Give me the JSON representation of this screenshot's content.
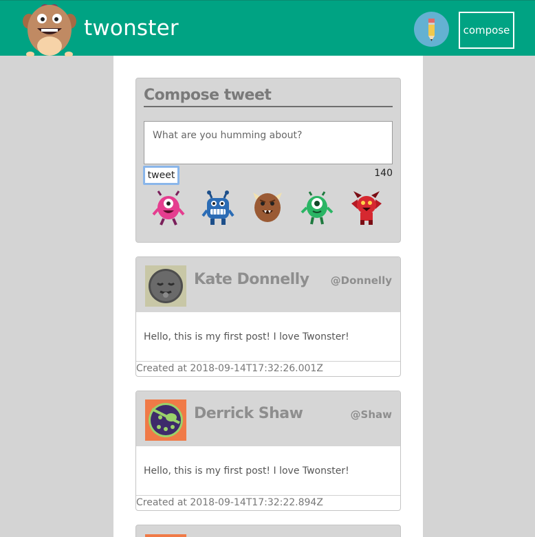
{
  "app": {
    "title": "twonster",
    "compose_label": "compose"
  },
  "compose": {
    "heading": "Compose tweet",
    "placeholder": "What are you humming about?",
    "tweet_label": "tweet",
    "counter": "140",
    "monsters": [
      "pink-monster-icon",
      "blue-monster-icon",
      "brown-monster-icon",
      "green-monster-icon",
      "red-monster-icon"
    ]
  },
  "tweets": [
    {
      "name": "Kate Donnelly",
      "handle": "@Donnelly",
      "text": "Hello, this is my first post! I love Twonster!",
      "created": "Created at 2018-09-14T17:32:26.001Z",
      "avatar": "sleepy-face-icon"
    },
    {
      "name": "Derrick Shaw",
      "handle": "@Shaw",
      "text": "Hello, this is my first post! I love Twonster!",
      "created": "Created at 2018-09-14T17:32:22.894Z",
      "avatar": "pirate-face-icon"
    }
  ],
  "colors": {
    "topbar": "#00a383",
    "background": "#d4d4d4",
    "card_header": "#d6d6d6",
    "text_gray": "#8e8e8e"
  }
}
